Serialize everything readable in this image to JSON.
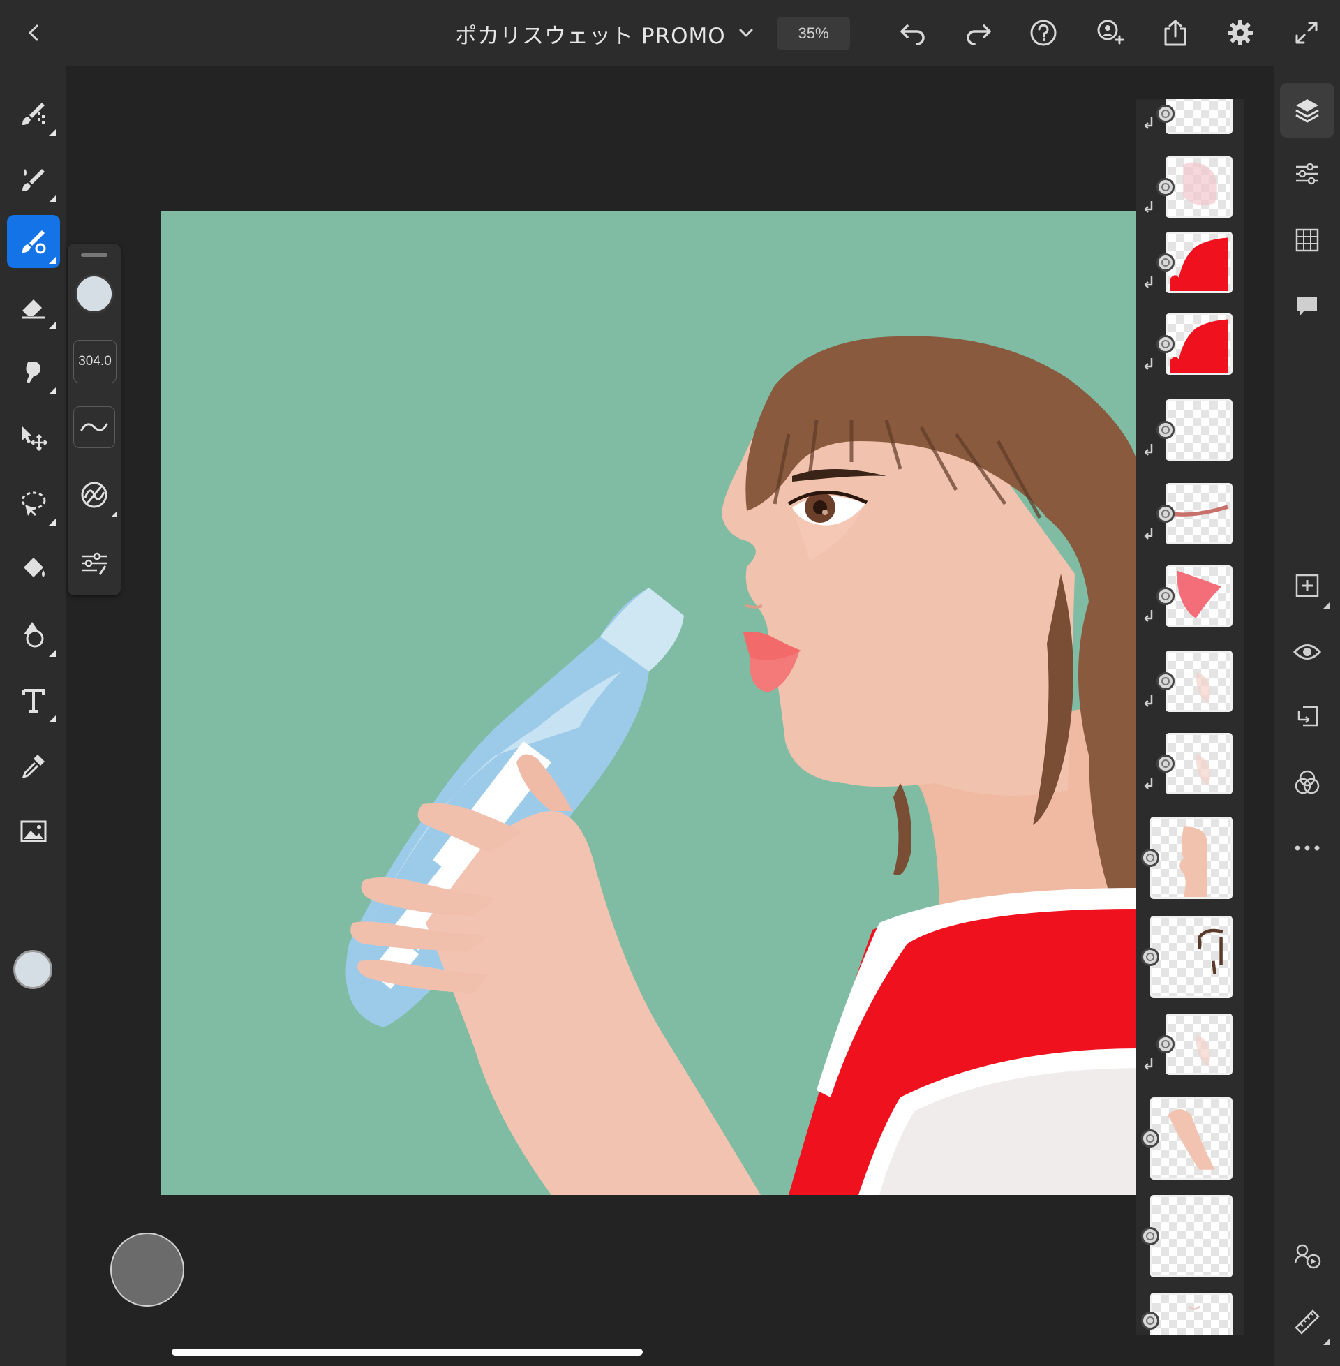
{
  "header": {
    "back_icon": "chevron-left-icon",
    "title": "ポカリスウェット PROMO",
    "title_dropdown_icon": "chevron-down-icon",
    "zoom": "35%",
    "actions": [
      "undo-icon",
      "redo-icon",
      "help-icon",
      "invite-icon",
      "share-icon",
      "settings-icon",
      "fullscreen-icon"
    ]
  },
  "tools": [
    "pixel-brush-icon",
    "live-brush-icon",
    "vector-brush-icon",
    "eraser-icon",
    "smudge-icon",
    "transform-icon",
    "selection-icon",
    "fill-icon",
    "shape-icon",
    "text-icon",
    "eyedropper-icon",
    "place-image-icon",
    "color-icon"
  ],
  "active_tool": "vector-brush-icon",
  "brush_panel": {
    "color": "#d5dde5",
    "size": "304.0",
    "buttons": [
      "smoothing-icon",
      "brush-settings-icon",
      "brush-adjust-icon"
    ]
  },
  "accent_color": "#1473e6",
  "layers": [
    {
      "id": 1,
      "content": "empty",
      "clipped": true
    },
    {
      "id": 2,
      "content": "blush",
      "clipped": true
    },
    {
      "id": 3,
      "content": "red-shirt",
      "clipped": true
    },
    {
      "id": 4,
      "content": "red-shirt",
      "clipped": true
    },
    {
      "id": 5,
      "content": "empty",
      "clipped": true
    },
    {
      "id": 6,
      "content": "mouth-line",
      "clipped": true
    },
    {
      "id": 7,
      "content": "lips",
      "clipped": true
    },
    {
      "id": 8,
      "content": "faint-skin",
      "clipped": true
    },
    {
      "id": 9,
      "content": "faint-skin",
      "clipped": true
    },
    {
      "id": 10,
      "content": "profile",
      "clipped": false
    },
    {
      "id": 11,
      "content": "hair-strands",
      "clipped": false
    },
    {
      "id": 12,
      "content": "faint-skin",
      "clipped": true
    },
    {
      "id": 13,
      "content": "arm",
      "clipped": false
    },
    {
      "id": 14,
      "content": "empty",
      "clipped": false
    },
    {
      "id": 15,
      "content": "partial",
      "clipped": false
    }
  ],
  "right_tools": [
    "layers-icon",
    "layer-properties-icon",
    "grid-icon",
    "comments-icon",
    "add-layer-icon",
    "visibility-icon",
    "clipping-mask-icon",
    "blend-mode-icon",
    "more-icon",
    "cloud-sync-icon",
    "ruler-icon"
  ],
  "canvas": {
    "background": "#7fbca3",
    "shirt_red": "#f0111e",
    "hair": "#8a5a3e",
    "skin": "#f1c2ad",
    "bottle": "#9ccbea"
  }
}
